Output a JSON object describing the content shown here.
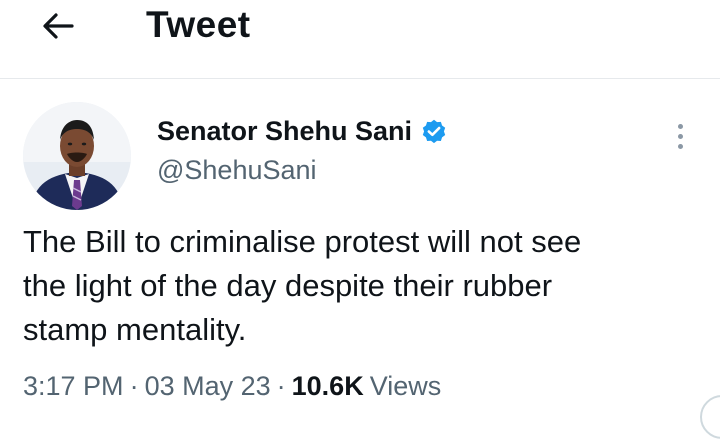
{
  "header": {
    "back_icon": "arrow-left-icon",
    "title": "Tweet"
  },
  "tweet": {
    "author": {
      "display_name": "Senator Shehu Sani",
      "handle": "@ShehuSani",
      "verified": true,
      "verified_icon": "verified-badge-icon",
      "verified_color": "#1d9bf0"
    },
    "more_icon": "more-vertical-icon",
    "text": "The Bill to criminalise protest will not see\nthe light of the day despite their rubber\nstamp mentality.",
    "time": "3:17 PM",
    "separator": "·",
    "date": "03 May 23",
    "views_count": "10.6K",
    "views_label": "Views"
  },
  "colors": {
    "text_primary": "#0f1419",
    "text_secondary": "#536471",
    "divider": "#e6e9ec",
    "accent": "#1d9bf0"
  }
}
